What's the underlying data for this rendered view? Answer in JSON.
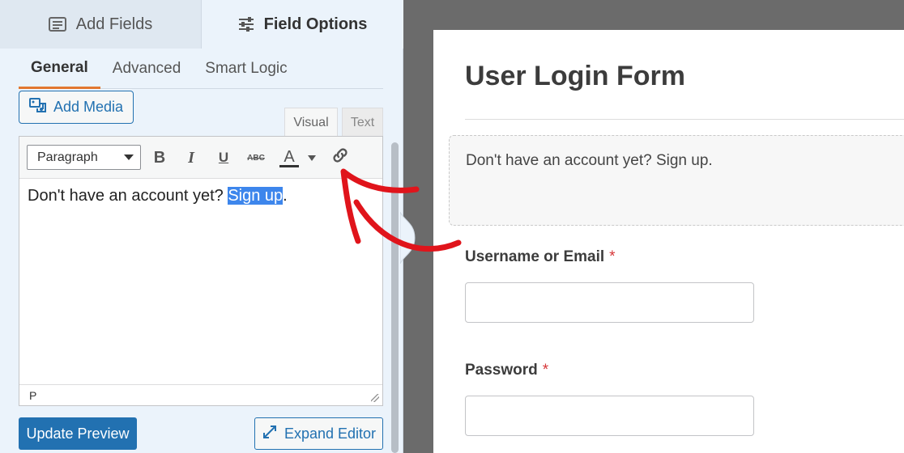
{
  "top_tabs": {
    "add_fields": "Add Fields",
    "field_options": "Field Options"
  },
  "sub_tabs": {
    "general": "General",
    "advanced": "Advanced",
    "smart_logic": "Smart Logic"
  },
  "add_media_label": "Add Media",
  "editor_modes": {
    "visual": "Visual",
    "text": "Text"
  },
  "toolbar": {
    "format_value": "Paragraph",
    "bold": "B",
    "italic": "I",
    "underline": "U",
    "strike": "ABC",
    "text_color": "A"
  },
  "editor": {
    "text_before": "Don't have an account yet? ",
    "selected_text": "Sign up",
    "text_after": ".",
    "status_path": "P"
  },
  "buttons": {
    "update_preview": "Update Preview",
    "expand_editor": "Expand Editor"
  },
  "preview": {
    "form_title": "User Login Form",
    "content_text": "Don't have an account yet? Sign up.",
    "fields": [
      {
        "label": "Username or Email",
        "required_mark": "*"
      },
      {
        "label": "Password",
        "required_mark": "*"
      }
    ]
  },
  "colors": {
    "accent_blue": "#2271b1",
    "active_tab_underline": "#e27730",
    "selection": "#3d86ec",
    "annotation_arrow": "#e0141b"
  }
}
